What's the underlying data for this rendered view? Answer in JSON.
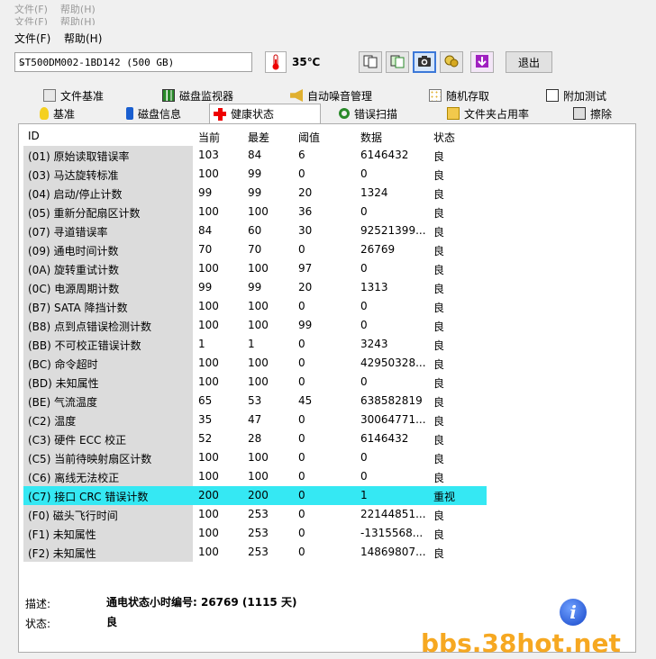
{
  "menu": {
    "file": "文件(F)",
    "help": "帮助(H)"
  },
  "toolbar": {
    "drive": "ST500DM002-1BD142 (500 GB)",
    "temperature": "35℃",
    "exit": "退出",
    "icons": [
      "thermometer-icon",
      "copy-icon",
      "paste-icon",
      "camera-icon",
      "hand-icon",
      "download-icon"
    ]
  },
  "tabs_row1": [
    "文件基准",
    "磁盘监视器",
    "自动噪音管理",
    "随机存取",
    "附加测试"
  ],
  "tabs_row2": [
    "基准",
    "磁盘信息",
    "健康状态",
    "错误扫描",
    "文件夹占用率",
    "擦除"
  ],
  "active_tab": "健康状态",
  "table": {
    "headers": [
      "ID",
      "当前",
      "最差",
      "阈值",
      "数据",
      "状态"
    ],
    "rows": [
      [
        "(01) 原始读取错误率",
        "103",
        "84",
        "6",
        "6146432",
        "良"
      ],
      [
        "(03) 马达旋转标准",
        "100",
        "99",
        "0",
        "0",
        "良"
      ],
      [
        "(04) 启动/停止计数",
        "99",
        "99",
        "20",
        "1324",
        "良"
      ],
      [
        "(05) 重新分配扇区计数",
        "100",
        "100",
        "36",
        "0",
        "良"
      ],
      [
        "(07) 寻道错误率",
        "84",
        "60",
        "30",
        "92521399...",
        "良"
      ],
      [
        "(09) 通电时间计数",
        "70",
        "70",
        "0",
        "26769",
        "良"
      ],
      [
        "(0A) 旋转重试计数",
        "100",
        "100",
        "97",
        "0",
        "良"
      ],
      [
        "(0C) 电源周期计数",
        "99",
        "99",
        "20",
        "1313",
        "良"
      ],
      [
        "(B7) SATA 降挡计数",
        "100",
        "100",
        "0",
        "0",
        "良"
      ],
      [
        "(B8) 点到点错误检测计数",
        "100",
        "100",
        "99",
        "0",
        "良"
      ],
      [
        "(BB) 不可校正错误计数",
        "1",
        "1",
        "0",
        "3243",
        "良"
      ],
      [
        "(BC) 命令超时",
        "100",
        "100",
        "0",
        "42950328...",
        "良"
      ],
      [
        "(BD) 未知属性",
        "100",
        "100",
        "0",
        "0",
        "良"
      ],
      [
        "(BE) 气流温度",
        "65",
        "53",
        "45",
        "638582819",
        "良"
      ],
      [
        "(C2) 温度",
        "35",
        "47",
        "0",
        "30064771...",
        "良"
      ],
      [
        "(C3) 硬件 ECC 校正",
        "52",
        "28",
        "0",
        "6146432",
        "良"
      ],
      [
        "(C5) 当前待映射扇区计数",
        "100",
        "100",
        "0",
        "0",
        "良"
      ],
      [
        "(C6) 离线无法校正",
        "100",
        "100",
        "0",
        "0",
        "良"
      ],
      [
        "(C7) 接口 CRC 错误计数",
        "200",
        "200",
        "0",
        "1",
        "重视"
      ],
      [
        "(F0) 磁头飞行时间",
        "100",
        "253",
        "0",
        "22144851...",
        "良"
      ],
      [
        "(F1) 未知属性",
        "100",
        "253",
        "0",
        "-1315568...",
        "良"
      ],
      [
        "(F2) 未知属性",
        "100",
        "253",
        "0",
        "14869807...",
        "良"
      ]
    ],
    "highlight_row": 18,
    "highlight_color": "#35e8f3"
  },
  "description": {
    "label": "描述:",
    "value": "通电状态小时编号: 26769 (1115 天)"
  },
  "status": {
    "label": "状态:",
    "value": "良"
  },
  "watermark": "bbs.38hot.net"
}
